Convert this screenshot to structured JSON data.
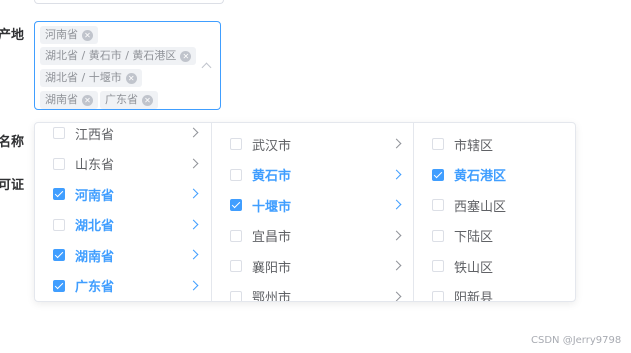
{
  "form": {
    "labels": [
      "产地",
      "名称",
      "可证"
    ]
  },
  "select": {
    "tags": [
      {
        "label": "河南省",
        "close": "✕"
      },
      {
        "label": "湖北省 / 黄石市 / 黄石港区",
        "close": "✕"
      },
      {
        "label": "湖北省 / 十堰市",
        "close": "✕"
      },
      {
        "label": "湖南省",
        "close": "✕"
      },
      {
        "label": "广东省",
        "close": "✕"
      }
    ],
    "icon": "chevron-up-icon"
  },
  "cascader": {
    "provinces": [
      {
        "label": "江西省",
        "checked": false,
        "active": false
      },
      {
        "label": "山东省",
        "checked": false,
        "active": false
      },
      {
        "label": "河南省",
        "checked": true,
        "active": true
      },
      {
        "label": "湖北省",
        "checked": false,
        "active": true
      },
      {
        "label": "湖南省",
        "checked": true,
        "active": true
      },
      {
        "label": "广东省",
        "checked": true,
        "active": true
      }
    ],
    "cities": [
      {
        "label": "武汉市",
        "checked": false,
        "active": false
      },
      {
        "label": "黄石市",
        "checked": false,
        "active": true
      },
      {
        "label": "十堰市",
        "checked": true,
        "active": true
      },
      {
        "label": "宜昌市",
        "checked": false,
        "active": false
      },
      {
        "label": "襄阳市",
        "checked": false,
        "active": false
      },
      {
        "label": "鄂州市",
        "checked": false,
        "active": false
      }
    ],
    "districts": [
      {
        "label": "市辖区",
        "checked": false,
        "active": false
      },
      {
        "label": "黄石港区",
        "checked": true,
        "active": true
      },
      {
        "label": "西塞山区",
        "checked": false,
        "active": false
      },
      {
        "label": "下陆区",
        "checked": false,
        "active": false
      },
      {
        "label": "铁山区",
        "checked": false,
        "active": false
      },
      {
        "label": "阳新县",
        "checked": false,
        "active": false
      }
    ]
  },
  "watermark": "CSDN @Jerry9798",
  "colors": {
    "accent": "#409eff",
    "text": "#606266",
    "tag_bg": "#f0f2f5"
  }
}
